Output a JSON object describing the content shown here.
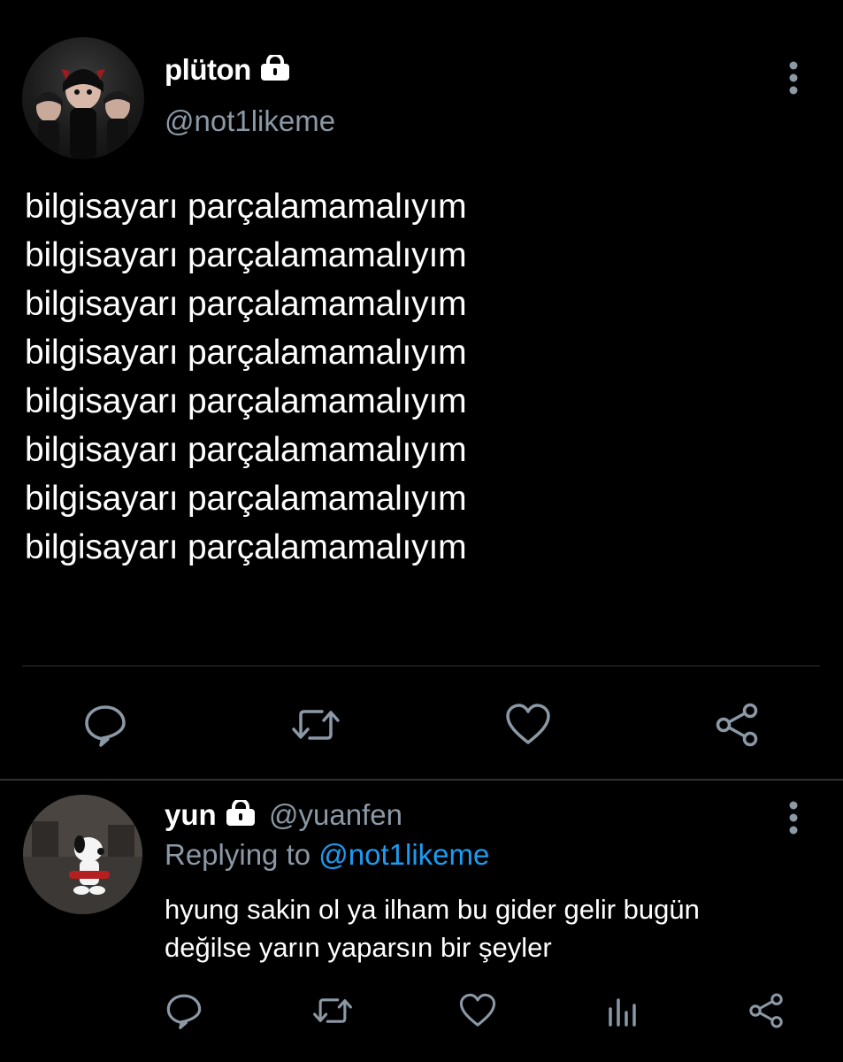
{
  "main_tweet": {
    "display_name": "plüton",
    "handle": "@not1likeme",
    "lines": [
      "bilgisayarı parçalamamalıyım",
      "bilgisayarı parçalamamalıyım",
      "bilgisayarı parçalamamalıyım",
      "bilgisayarı parçalamamalıyım",
      "bilgisayarı parçalamamalıyım",
      "bilgisayarı parçalamamalıyım",
      "bilgisayarı parçalamamalıyım",
      "bilgisayarı parçalamamalıyım"
    ],
    "actions": [
      "reply-icon",
      "retweet-icon",
      "like-icon",
      "share-icon"
    ]
  },
  "reply_tweet": {
    "display_name": "yun",
    "handle": "@yuanfen",
    "replying_prefix": "Replying to",
    "replying_mention": "@not1likeme",
    "lines": [
      "hyung sakin ol ya ilham bu gider gelir bugün",
      "değilse yarın yaparsın bir şeyler"
    ],
    "actions": [
      "reply-icon",
      "retweet-icon",
      "like-icon",
      "analytics-icon",
      "share-icon"
    ]
  },
  "colors": {
    "background": "#000000",
    "text": "#ffffff",
    "muted": "#8b98a5",
    "accent": "#1d9bf0",
    "icon": "#8b98a5",
    "divider": "#2f3336"
  }
}
